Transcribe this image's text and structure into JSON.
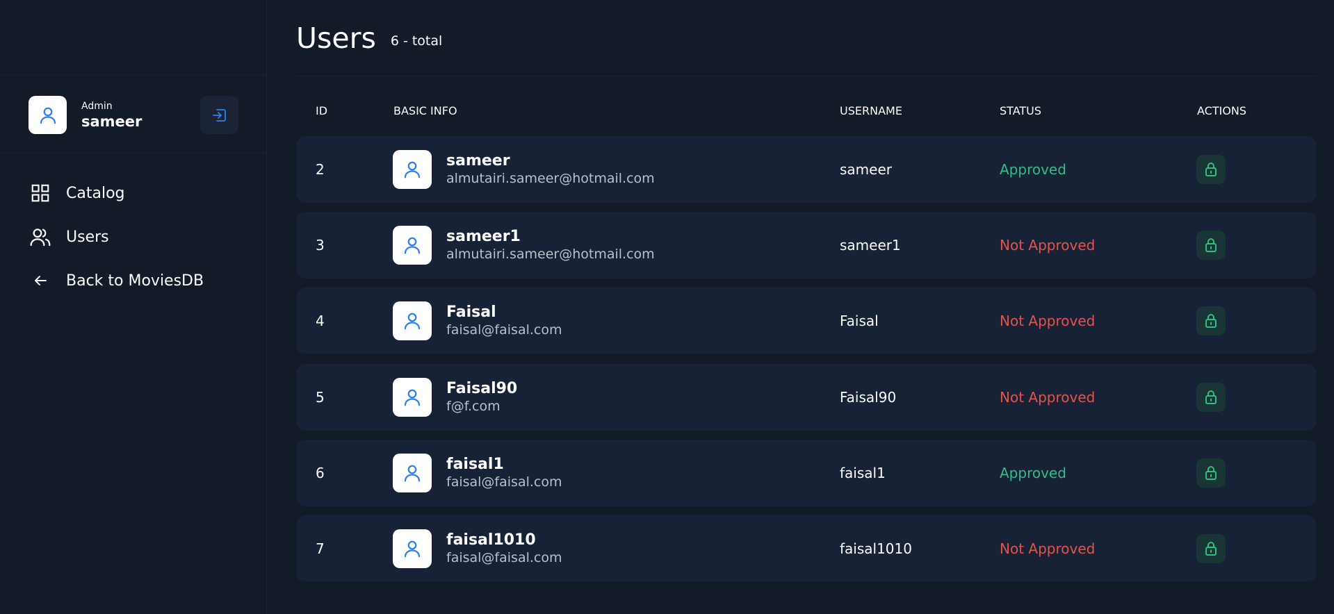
{
  "profile": {
    "role": "Admin",
    "name": "sameer"
  },
  "nav": [
    {
      "label": "Catalog",
      "icon": "grid-icon"
    },
    {
      "label": "Users",
      "icon": "users-icon"
    },
    {
      "label": "Back to MoviesDB",
      "icon": "arrow-left-icon"
    }
  ],
  "header": {
    "title": "Users",
    "count": "6 - total"
  },
  "table": {
    "columns": {
      "id": "ID",
      "info": "BASIC INFO",
      "username": "USERNAME",
      "status": "STATUS",
      "actions": "ACTIONS"
    },
    "rows": [
      {
        "id": "2",
        "name": "sameer",
        "email": "almutairi.sameer@hotmail.com",
        "username": "sameer",
        "status": "Approved"
      },
      {
        "id": "3",
        "name": "sameer1",
        "email": "almutairi.sameer@hotmail.com",
        "username": "sameer1",
        "status": "Not Approved"
      },
      {
        "id": "4",
        "name": "Faisal",
        "email": "faisal@faisal.com",
        "username": "Faisal",
        "status": "Not Approved"
      },
      {
        "id": "5",
        "name": "Faisal90",
        "email": "f@f.com",
        "username": "Faisal90",
        "status": "Not Approved"
      },
      {
        "id": "6",
        "name": "faisal1",
        "email": "faisal@faisal.com",
        "username": "faisal1",
        "status": "Approved"
      },
      {
        "id": "7",
        "name": "faisal1010",
        "email": "faisal@faisal.com",
        "username": "faisal1010",
        "status": "Not Approved"
      }
    ]
  },
  "colors": {
    "background": "#131a28",
    "row": "#182237",
    "accent": "#2f80ed",
    "approved": "#2fbf80",
    "not_approved": "#e5534b"
  }
}
